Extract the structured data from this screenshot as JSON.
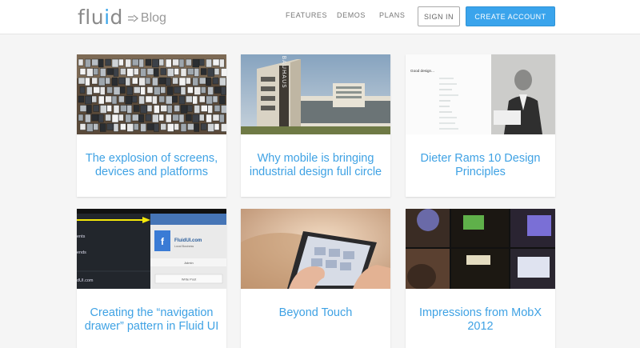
{
  "header": {
    "logo_text": "fluid",
    "logo_blog": "Blog",
    "nav": [
      "FEATURES",
      "DEMOS",
      "PLANS"
    ],
    "signin_label": "SIGN IN",
    "create_label": "CREATE ACCOUNT"
  },
  "colors": {
    "accent": "#3aa4ec",
    "title_blue": "#3fa2e4",
    "background": "#f5f5f5"
  },
  "posts": [
    {
      "title": "The explosion of screens, devices and platforms",
      "image": "screens-wall-photo"
    },
    {
      "title": "Why mobile is bringing industrial design full circle",
      "image": "bauhaus-building-photo"
    },
    {
      "title": "Dieter Rams 10 Design Principles",
      "image": "dieter-rams-photo"
    },
    {
      "title": "Creating the “navigation drawer” pattern in Fluid UI",
      "image": "navigation-drawer-screenshot"
    },
    {
      "title": "Beyond Touch",
      "image": "tablet-hands-photo"
    },
    {
      "title": "Impressions from MobX 2012",
      "image": "mobx-conference-photos"
    }
  ],
  "thumbnails": {
    "bauhaus_sign": "BAUHAUS",
    "rams_heading": "Good design...",
    "drawer_brand": "FluidUI.com",
    "drawer_subtitle": "Local Business",
    "drawer_admin": "Admin",
    "drawer_write": "Write Post",
    "drawer_menu": [
      "ents",
      "ends",
      "dUI.com"
    ]
  }
}
